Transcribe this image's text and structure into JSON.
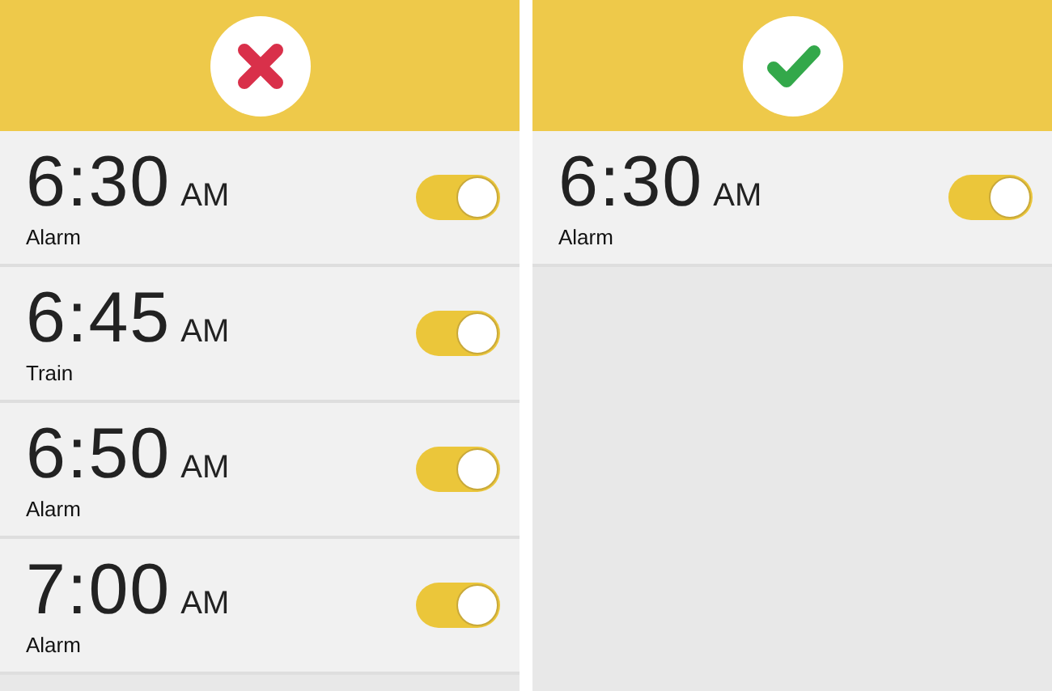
{
  "panels": [
    {
      "kind": "wrong",
      "alarms": [
        {
          "time": "6:30",
          "period": "AM",
          "label": "Alarm",
          "on": true
        },
        {
          "time": "6:45",
          "period": "AM",
          "label": "Train",
          "on": true
        },
        {
          "time": "6:50",
          "period": "AM",
          "label": "Alarm",
          "on": true
        },
        {
          "time": "7:00",
          "period": "AM",
          "label": "Alarm",
          "on": true
        }
      ]
    },
    {
      "kind": "right",
      "alarms": [
        {
          "time": "6:30",
          "period": "AM",
          "label": "Alarm",
          "on": true
        }
      ]
    }
  ]
}
